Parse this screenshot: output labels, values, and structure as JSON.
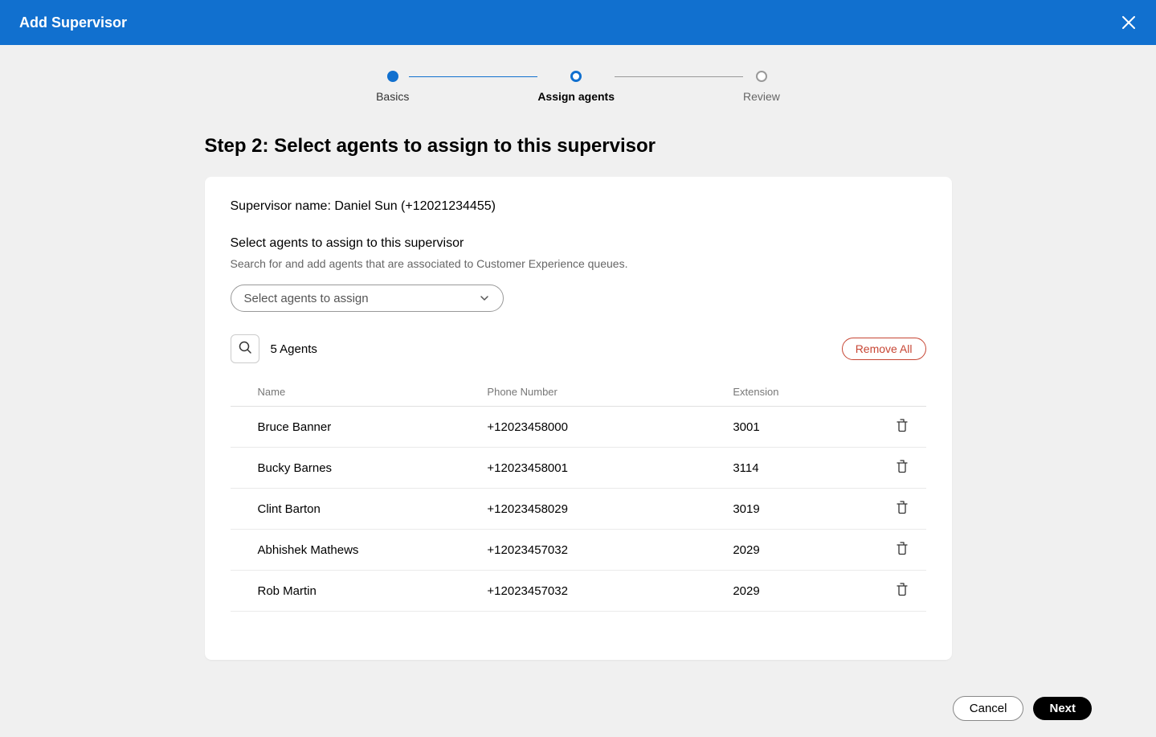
{
  "header": {
    "title": "Add Supervisor"
  },
  "stepper": {
    "step1_label": "Basics",
    "step2_label": "Assign agents",
    "step3_label": "Review"
  },
  "page": {
    "step_heading": "Step 2: Select agents to assign to this supervisor",
    "supervisor_line": "Supervisor name: Daniel Sun (+12021234455)",
    "section_title": "Select agents to assign to this supervisor",
    "section_desc": "Search for and add agents that are associated to Customer Experience queues.",
    "select_placeholder": "Select agents to assign",
    "agent_count": "5 Agents",
    "remove_all_label": "Remove All"
  },
  "table": {
    "col_name": "Name",
    "col_phone": "Phone Number",
    "col_ext": "Extension",
    "rows": [
      {
        "name": "Bruce Banner",
        "phone": "+12023458000",
        "ext": "3001"
      },
      {
        "name": "Bucky Barnes",
        "phone": "+12023458001",
        "ext": "3114"
      },
      {
        "name": "Clint Barton",
        "phone": "+12023458029",
        "ext": "3019"
      },
      {
        "name": "Abhishek Mathews",
        "phone": "+12023457032",
        "ext": "2029"
      },
      {
        "name": "Rob Martin",
        "phone": "+12023457032",
        "ext": "2029"
      }
    ]
  },
  "footer": {
    "cancel_label": "Cancel",
    "next_label": "Next"
  }
}
